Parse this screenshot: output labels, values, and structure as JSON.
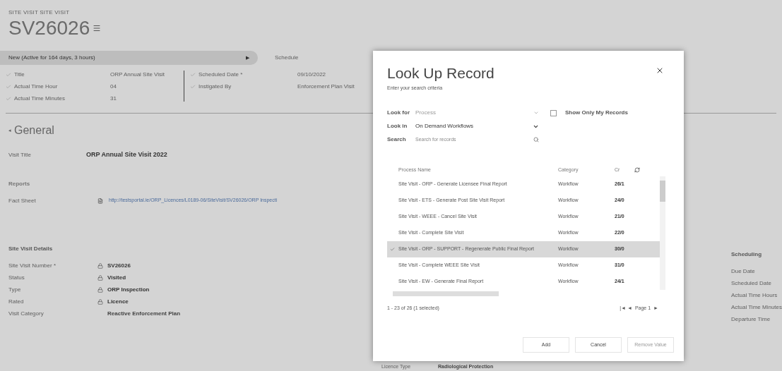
{
  "record": {
    "entity_label": "SITE VISIT SITE VISIT",
    "title": "SV26026"
  },
  "process": {
    "stage": "New (Active for 164 days, 3 hours)",
    "arrow": "▶",
    "next_stage": "Schedule",
    "fields_left": [
      {
        "label": "Title",
        "value": "ORP Annual Site Visit"
      },
      {
        "label": "Actual Time Hour",
        "value": "04"
      },
      {
        "label": "Actual Time Minutes",
        "value": "31"
      }
    ],
    "fields_right": [
      {
        "label": "Scheduled Date *",
        "value": "09/10/2022"
      },
      {
        "label": "Instigated By",
        "value": "Enforcement Plan Visit"
      }
    ]
  },
  "section": {
    "collapse": "◂",
    "title": "General",
    "visit_title": {
      "label": "Visit Title",
      "value": "ORP Annual Site Visit 2022"
    },
    "reports": {
      "heading": "Reports",
      "fields": [
        {
          "label": "Fact Sheet",
          "value": "http://testsportal.ie/ORP_Licences/L0189-06/SiteVisit/SV26026/ORP Inspecti"
        }
      ]
    },
    "details": {
      "heading": "Site Visit Details",
      "fields": [
        {
          "label": "Site Visit Number *",
          "value": "SV26026",
          "locked": true
        },
        {
          "label": "Status",
          "value": "Visited",
          "locked": true
        },
        {
          "label": "Type",
          "value": "ORP Inspection",
          "locked": true
        },
        {
          "label": "Rated",
          "value": "Licence",
          "locked": true
        },
        {
          "label": "Visit Category",
          "value": "Reactive Enforcement Plan",
          "locked": false
        }
      ]
    }
  },
  "middle_field": {
    "label": "Licence Type",
    "value": "Radiological Protection"
  },
  "scheduling": {
    "heading": "Scheduling",
    "fields": [
      "Due Date",
      "Scheduled Date",
      "Actual Time Hours",
      "Actual Time Minutes",
      "Departure Time"
    ]
  },
  "dialog": {
    "title": "Look Up Record",
    "subtitle": "Enter your search criteria",
    "look_for": {
      "label": "Look for",
      "value": "Process",
      "disabled": true
    },
    "only_mine": {
      "label": "Show Only My Records",
      "checked": false
    },
    "look_in": {
      "label": "Look in",
      "value": "On Demand Workflows"
    },
    "search": {
      "label": "Search",
      "placeholder": "Search for records"
    },
    "columns": [
      "Process Name",
      "Category",
      "Cr"
    ],
    "rows": [
      {
        "name": "Site Visit - ORP - Generate Licensee Final Report",
        "category": "Workflow",
        "created": "26/1",
        "selected": false
      },
      {
        "name": "Site Visit - ETS - Generate Post Site Visit Report",
        "category": "Workflow",
        "created": "24/0",
        "selected": false
      },
      {
        "name": "Site Visit - WEEE - Cancel Site Visit",
        "category": "Workflow",
        "created": "21/0",
        "selected": false
      },
      {
        "name": "Site Visit - Complete Site Visit",
        "category": "Workflow",
        "created": "22/0",
        "selected": false
      },
      {
        "name": "Site Visit - ORP - SUPPORT - Regenerate Public Final Report",
        "category": "Workflow",
        "created": "30/0",
        "selected": true
      },
      {
        "name": "Site Visit - Complete WEEE Site Visit",
        "category": "Workflow",
        "created": "31/0",
        "selected": false
      },
      {
        "name": "Site Visit - EW - Generate Final Report",
        "category": "Workflow",
        "created": "24/1",
        "selected": false
      }
    ],
    "status": "1 - 23 of 26 (1 selected)",
    "pager_back": "|◄ ◄",
    "page": "Page 1",
    "pager_next": "►",
    "buttons": [
      {
        "label": "Add",
        "disabled": false
      },
      {
        "label": "Cancel",
        "disabled": false
      },
      {
        "label": "Remove Value",
        "disabled": true
      }
    ]
  }
}
